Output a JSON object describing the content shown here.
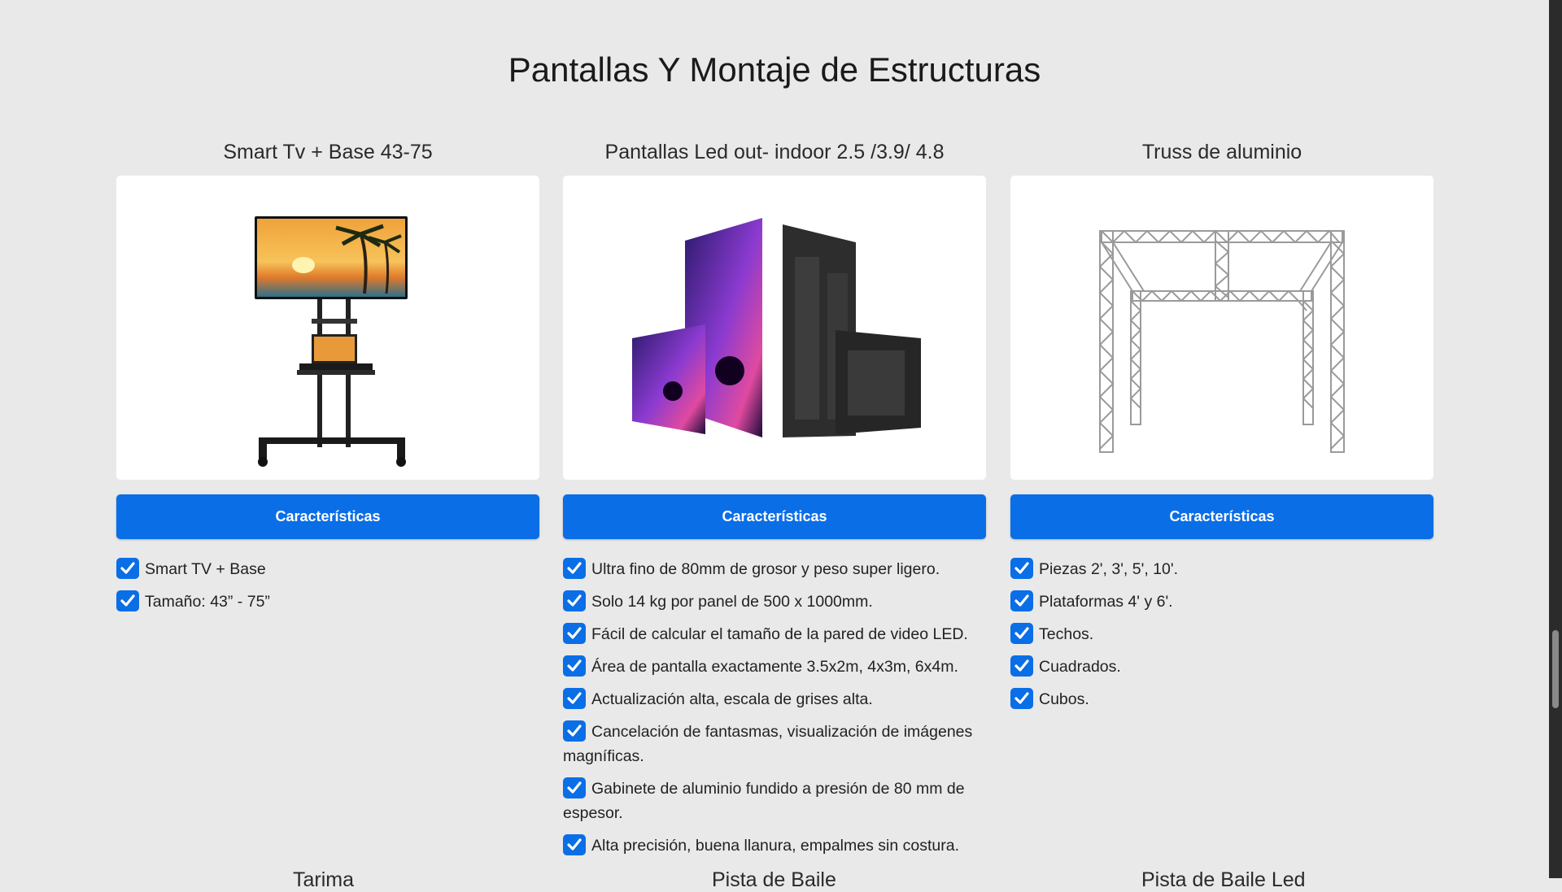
{
  "page": {
    "title": "Pantallas Y Montaje de Estructuras"
  },
  "products": [
    {
      "title": "Smart Tv + Base 43-75",
      "image": "tv-stand-image",
      "button_label": "Características",
      "features": [
        "Smart TV + Base",
        "Tamaño: 43” - 75”"
      ]
    },
    {
      "title": "Pantallas Led out- indoor 2.5 /3.9/ 4.8",
      "image": "led-panels-image",
      "button_label": "Características",
      "features": [
        "Ultra fino de 80mm de grosor y peso super ligero.",
        "Solo 14 kg por panel de 500 x 1000mm.",
        "Fácil de calcular el tamaño de la pared de video LED.",
        "Área de pantalla exactamente 3.5x2m, 4x3m, 6x4m.",
        "Actualización alta, escala de grises alta.",
        "Cancelación de fantasmas, visualización de imágenes magníficas.",
        "Gabinete de aluminio fundido a presión de 80 mm de espesor.",
        "Alta precisión, buena llanura, empalmes sin costura."
      ]
    },
    {
      "title": "Truss de aluminio",
      "image": "aluminum-truss-image",
      "button_label": "Características",
      "features": [
        "Piezas 2', 3', 5', 10'.",
        "Plataformas 4' y 6'.",
        "Techos.",
        "Cuadrados.",
        "Cubos."
      ]
    }
  ],
  "next_row": {
    "titles": [
      "Tarima",
      "Pista de Baile",
      "Pista de Baile Led"
    ]
  },
  "colors": {
    "background": "#e9e9e9",
    "button": "#0a6ee6",
    "check": "#0a6ee6"
  },
  "icons": {
    "check": "check-square-icon"
  }
}
